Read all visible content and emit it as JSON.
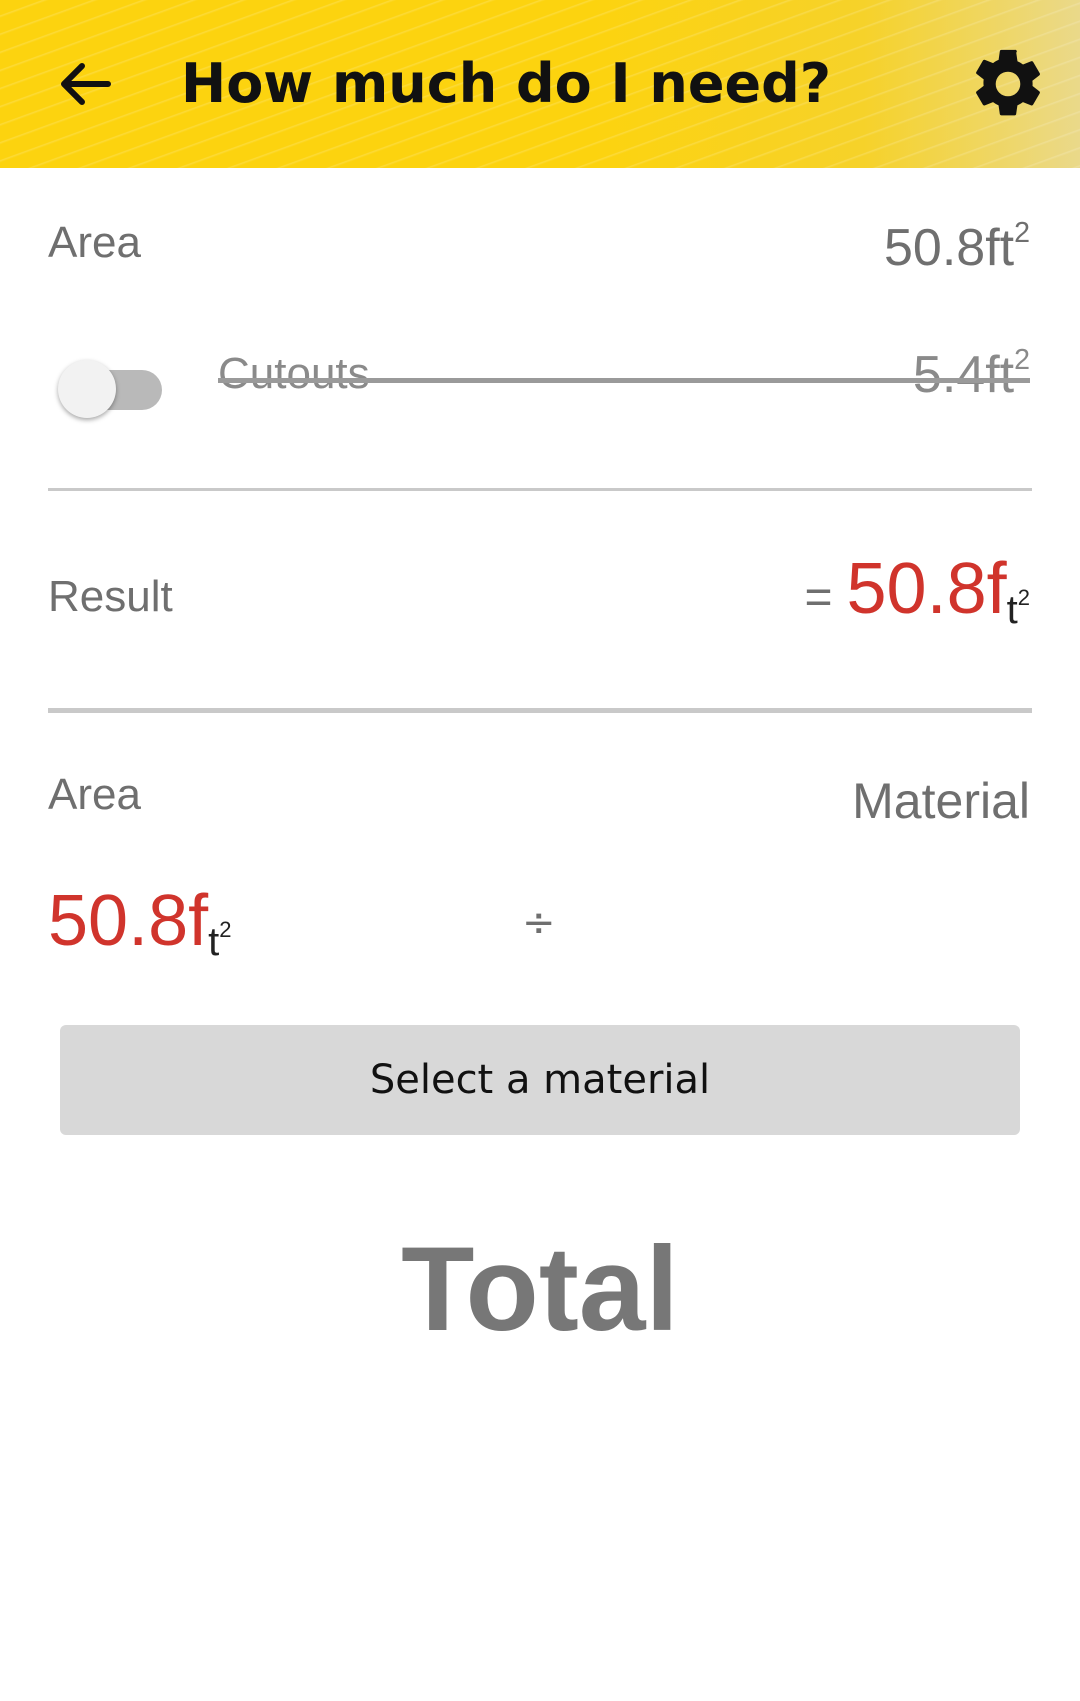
{
  "appbar": {
    "title": "How much do I need?",
    "back_icon": "arrow-left-icon",
    "settings_icon": "gear-icon",
    "color": "#fcd30f"
  },
  "area_row": {
    "label": "Area",
    "value": "50.8ft",
    "unit_sup": "2"
  },
  "cutouts_row": {
    "toggle_on": false,
    "label": "Cutouts",
    "value": "5.4ft",
    "unit_sup": "2"
  },
  "result_row": {
    "label": "Result",
    "equals": "=",
    "value": "50.8f",
    "unit": "t",
    "unit_sup": "2",
    "value_color": "#d0342c"
  },
  "calc": {
    "area_label": "Area",
    "material_label": "Material",
    "area_value": "50.8f",
    "area_unit": "t",
    "area_unit_sup": "2",
    "operator": "÷"
  },
  "select_material_button": "Select a material",
  "total_label": "Total"
}
